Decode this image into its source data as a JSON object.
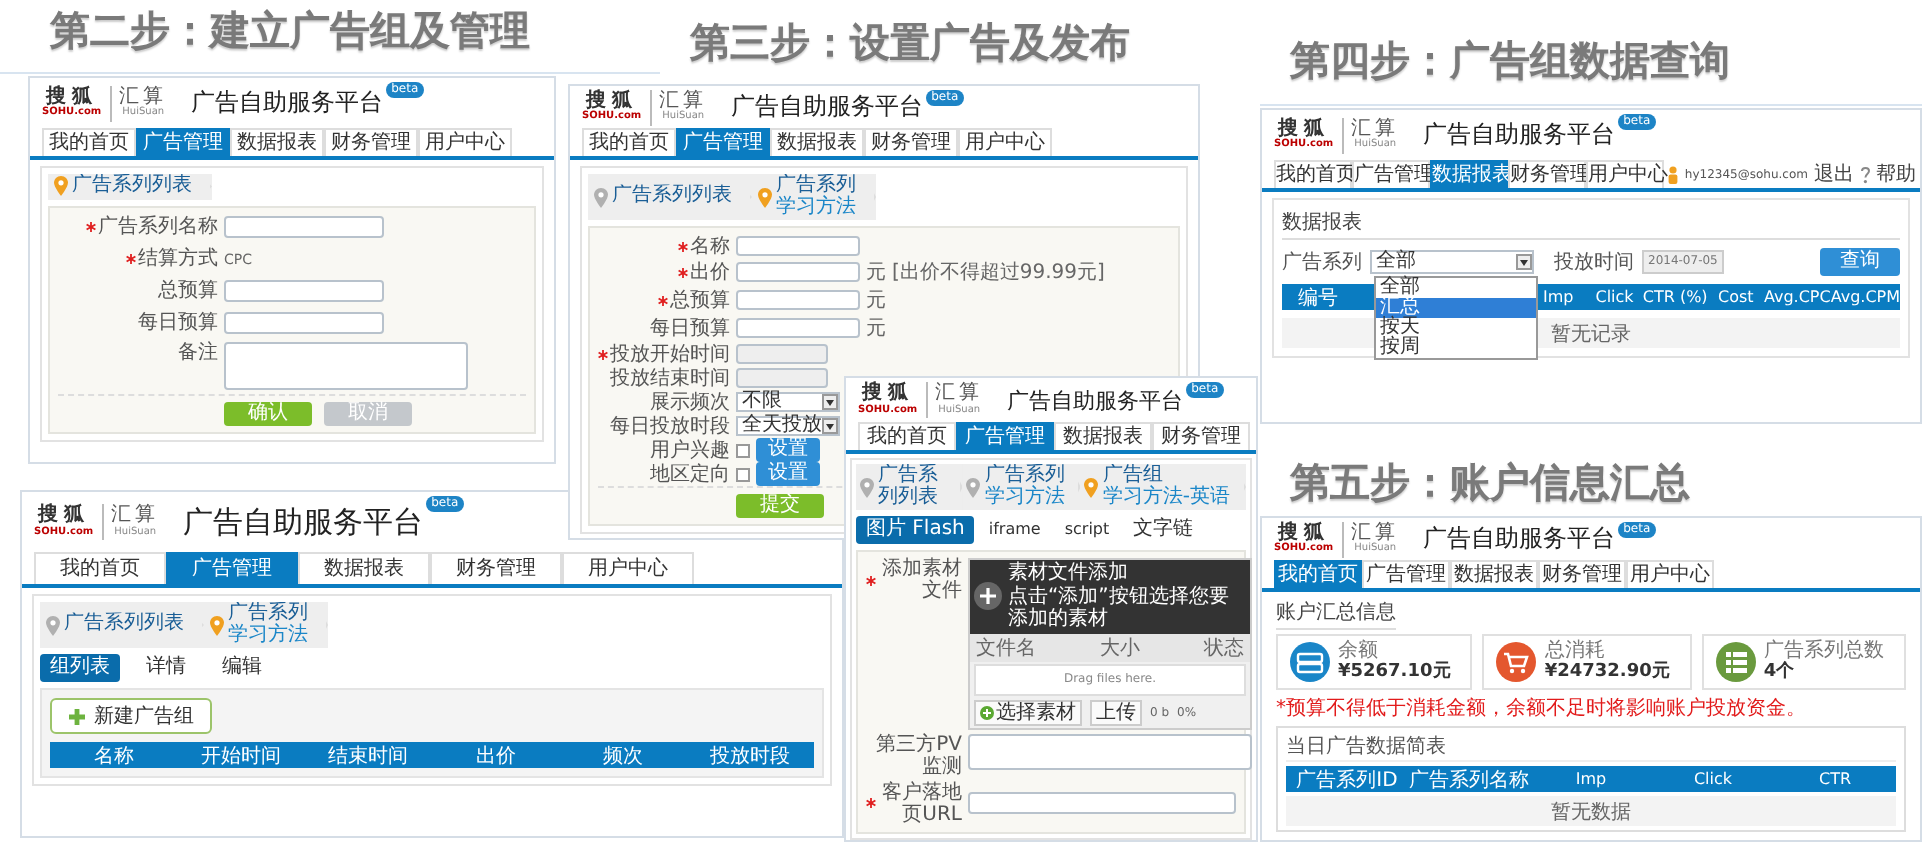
{
  "screens": [
    {
      "kind": "group_form",
      "heading": "第二步：建立广告组及管理",
      "header": {
        "brand": "搜狐",
        "domain": "SOHU.com",
        "product": "汇算",
        "product_en": "HuiSuan",
        "title": "广告自助服务平台",
        "badge": "beta",
        "tabs": [
          {
            "label": "我的首页",
            "selected": false
          },
          {
            "label": "广告管理",
            "selected": true
          },
          {
            "label": "数据报表",
            "selected": false
          },
          {
            "label": "财务管理",
            "selected": false
          },
          {
            "label": "用户中心",
            "selected": false
          }
        ]
      },
      "breadcrumb": [
        {
          "title": "广告系列列表",
          "selected": true
        }
      ],
      "fields": [
        {
          "label": "广告系列名称",
          "required": true,
          "kind": "input"
        },
        {
          "label": "结算方式",
          "required": true,
          "kind": "text",
          "value": "CPC"
        },
        {
          "label": "总预算",
          "required": false,
          "kind": "input"
        },
        {
          "label": "每日预算",
          "required": false,
          "kind": "input"
        },
        {
          "label": "备注",
          "required": false,
          "kind": "textarea"
        }
      ],
      "buttons": [
        {
          "label": "确认",
          "kind": "primary"
        },
        {
          "label": "取消",
          "kind": "secondary"
        }
      ]
    },
    {
      "kind": "ad_form",
      "heading": "第三步：设置广告及发布",
      "header": {
        "brand": "搜狐",
        "domain": "SOHU.com",
        "product": "汇算",
        "product_en": "HuiSuan",
        "title": "广告自助服务平台",
        "badge": "beta",
        "tabs": [
          {
            "label": "我的首页",
            "selected": false
          },
          {
            "label": "广告管理",
            "selected": true
          },
          {
            "label": "数据报表",
            "selected": false
          },
          {
            "label": "财务管理",
            "selected": false
          },
          {
            "label": "用户中心",
            "selected": false
          }
        ]
      },
      "breadcrumb": [
        {
          "title": "广告系列列表",
          "selected": false
        },
        {
          "title": "广告系列",
          "sub": "学习方法",
          "selected": true
        }
      ],
      "fields": [
        {
          "label": "名称",
          "required": true,
          "kind": "input"
        },
        {
          "label": "出价",
          "required": true,
          "kind": "input",
          "unit": "元",
          "note": "[出价不得超过99.99元]"
        },
        {
          "label": "总预算",
          "required": true,
          "kind": "input",
          "unit": "元"
        },
        {
          "label": "每日预算",
          "required": false,
          "kind": "input",
          "unit": "元"
        },
        {
          "label": "投放开始时间",
          "required": true,
          "kind": "disabled_input"
        },
        {
          "label": "投放结束时间",
          "required": false,
          "kind": "disabled_input"
        },
        {
          "label": "展示频次",
          "required": false,
          "kind": "select",
          "value": "不限"
        },
        {
          "label": "每日投放时段",
          "required": false,
          "kind": "select",
          "value": "全天投放"
        },
        {
          "label": "用户兴趣",
          "required": false,
          "kind": "checkbox",
          "checked": false,
          "button": "设置"
        },
        {
          "label": "地区定向",
          "required": false,
          "kind": "checkbox",
          "checked": false,
          "button": "设置"
        }
      ],
      "buttons": [
        {
          "label": "提交",
          "kind": "primary"
        }
      ]
    },
    {
      "kind": "report",
      "heading": "第四步：广告组数据查询",
      "header": {
        "brand": "搜狐",
        "domain": "SOHU.com",
        "product": "汇算",
        "product_en": "HuiSuan",
        "title": "广告自助服务平台",
        "badge": "beta",
        "tabs": [
          {
            "label": "我的首页",
            "selected": false
          },
          {
            "label": "广告管理",
            "selected": false
          },
          {
            "label": "数据报表",
            "selected": true
          },
          {
            "label": "财务管理",
            "selected": false
          },
          {
            "label": "用户中心",
            "selected": false
          }
        ],
        "user": {
          "email": "hy12345@sohu.com",
          "logout": "退出",
          "help": "帮助"
        }
      },
      "section_title": "数据报表",
      "filter_label": "广告系列",
      "filter_value": "全部",
      "date_label": "投放时间",
      "date_value": "2014-07-05",
      "query_button": "查询",
      "dropdown": [
        {
          "label": "全部",
          "selected": false
        },
        {
          "label": "汇总",
          "selected": true
        },
        {
          "label": "按天",
          "selected": false
        },
        {
          "label": "按周",
          "selected": false
        }
      ],
      "columns": [
        "编号",
        "Imp",
        "Click",
        "CTR (%)",
        "Cost",
        "Avg.CPC",
        "Avg.CPM"
      ],
      "empty_text": "暂无记录"
    },
    {
      "kind": "group_list",
      "header": {
        "brand": "搜狐",
        "domain": "SOHU.com",
        "product": "汇算",
        "product_en": "HuiSuan",
        "title": "广告自助服务平台",
        "badge": "beta",
        "tabs": [
          {
            "label": "我的首页",
            "selected": false
          },
          {
            "label": "广告管理",
            "selected": true
          },
          {
            "label": "数据报表",
            "selected": false
          },
          {
            "label": "财务管理",
            "selected": false
          },
          {
            "label": "用户中心",
            "selected": false
          }
        ]
      },
      "breadcrumb": [
        {
          "title": "广告系列列表",
          "selected": false
        },
        {
          "title": "广告系列",
          "sub": "学习方法",
          "selected": true
        }
      ],
      "subtabs": [
        {
          "label": "组列表",
          "selected": true
        },
        {
          "label": "详情",
          "selected": false
        },
        {
          "label": "编辑",
          "selected": false
        }
      ],
      "new_button": "新建广告组",
      "columns": [
        "名称",
        "开始时间",
        "结束时间",
        "出价",
        "频次",
        "投放时段"
      ]
    },
    {
      "kind": "creative_form",
      "header": {
        "brand": "搜狐",
        "domain": "SOHU.com",
        "product": "汇算",
        "product_en": "HuiSuan",
        "title": "广告自助服务平台",
        "badge": "beta",
        "tabs": [
          {
            "label": "我的首页",
            "selected": false
          },
          {
            "label": "广告管理",
            "selected": true
          },
          {
            "label": "数据报表",
            "selected": false
          },
          {
            "label": "财务管理",
            "selected": false
          }
        ]
      },
      "breadcrumb": [
        {
          "title": "广告系列列表",
          "selected": false
        },
        {
          "title": "广告系列",
          "sub": "学习方法",
          "selected": false
        },
        {
          "title": "广告组",
          "sub": "学习方法-英语",
          "selected": true
        }
      ],
      "subtabs": [
        {
          "label": "图片 Flash",
          "selected": true
        },
        {
          "label": "iframe",
          "selected": false
        },
        {
          "label": "script",
          "selected": false
        },
        {
          "label": "文字链",
          "selected": false
        }
      ],
      "fields": [
        {
          "label": "添加素材文件",
          "required": true,
          "kind": "uploader",
          "title": "素材文件添加",
          "hint": "点击“添加”按钮选择您要添加的素材",
          "columns": [
            "文件名",
            "大小",
            "状态"
          ],
          "drop_text": "Drag files here.",
          "choose_button": "选择素材",
          "upload_button": "上传",
          "size": "0 b",
          "percent": "0%"
        },
        {
          "label": "第三方PV监测",
          "required": false,
          "kind": "textarea"
        },
        {
          "label": "客户落地页URL",
          "required": true,
          "kind": "input"
        }
      ]
    },
    {
      "kind": "summary",
      "heading": "第五步：账户信息汇总",
      "header": {
        "brand": "搜狐",
        "domain": "SOHU.com",
        "product": "汇算",
        "product_en": "HuiSuan",
        "title": "广告自助服务平台",
        "badge": "beta",
        "tabs": [
          {
            "label": "我的首页",
            "selected": true
          },
          {
            "label": "广告管理",
            "selected": false
          },
          {
            "label": "数据报表",
            "selected": false
          },
          {
            "label": "财务管理",
            "selected": false
          },
          {
            "label": "用户中心",
            "selected": false
          }
        ]
      },
      "section_title": "账户汇总信息",
      "cards": [
        {
          "kind": "balance",
          "label": "余额",
          "value": "¥5267.10元",
          "color": "#1a86c8"
        },
        {
          "kind": "spend",
          "label": "总消耗",
          "value": "¥24732.90元",
          "color": "#e4572e"
        },
        {
          "kind": "count",
          "label": "广告系列总数",
          "value": "4个",
          "color": "#6a9a3e"
        }
      ],
      "notice": "*预算不得低于消耗金额，余额不足时将影响账户投放资金。",
      "table_title": "当日广告数据简表",
      "columns": [
        "广告系列ID",
        "广告系列名称",
        "Imp",
        "Click",
        "CTR"
      ],
      "empty_text": "暂无数据"
    }
  ]
}
